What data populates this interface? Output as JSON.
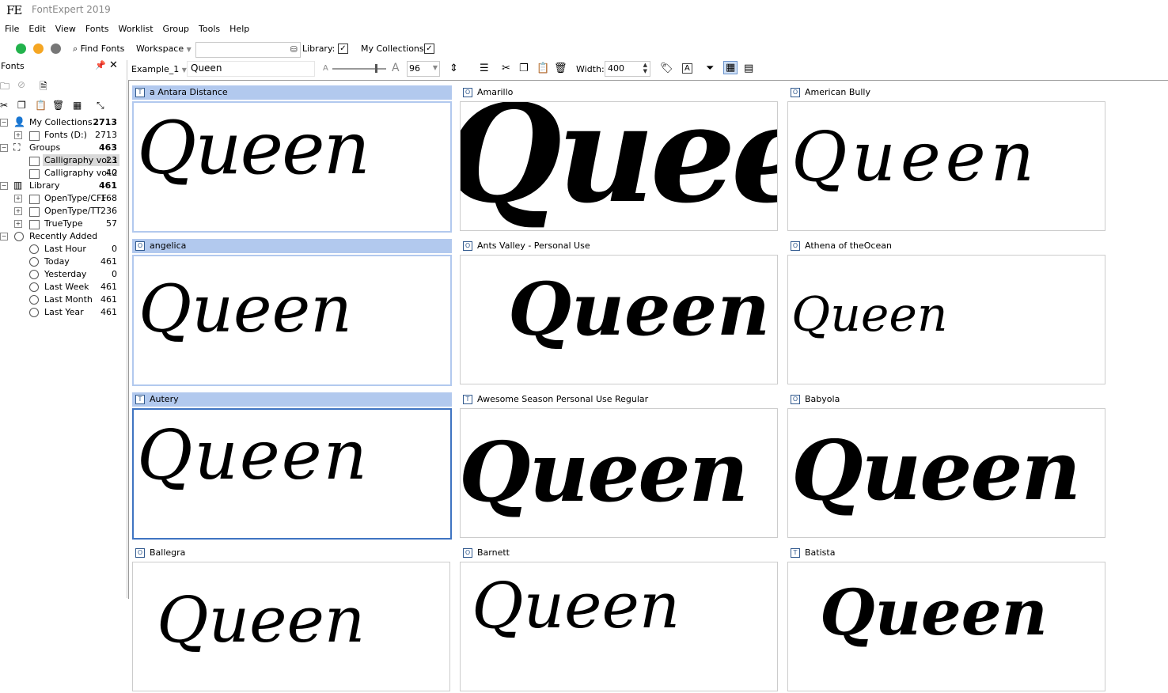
{
  "app": {
    "logo": "FE",
    "title": "FontExpert 2019"
  },
  "menu": [
    "File",
    "Edit",
    "View",
    "Fonts",
    "Worklist",
    "Group",
    "Tools",
    "Help"
  ],
  "toolbar1": {
    "find_fonts": "Find Fonts",
    "workspace": "Workspace",
    "library_label": "Library:",
    "collections_label": "My Collections:",
    "check": "✓"
  },
  "leftpanel": {
    "title": "Fonts",
    "tree": [
      {
        "label": "My Collections",
        "count": "2713",
        "bold": true
      },
      {
        "label": "Fonts (D:)",
        "count": "2713"
      },
      {
        "label": "Groups",
        "count": "463",
        "bold": true
      },
      {
        "label": "Calligraphy vol.1",
        "count": "23"
      },
      {
        "label": "Calligraphy vol.2",
        "count": "40"
      },
      {
        "label": "Library",
        "count": "461",
        "bold": true
      },
      {
        "label": "OpenType/CFF",
        "count": "168"
      },
      {
        "label": "OpenType/TT",
        "count": "236"
      },
      {
        "label": "TrueType",
        "count": "57"
      },
      {
        "label": "Recently Added",
        "count": ""
      },
      {
        "label": "Last Hour",
        "count": "0"
      },
      {
        "label": "Today",
        "count": "461"
      },
      {
        "label": "Yesterday",
        "count": "0"
      },
      {
        "label": "Last Week",
        "count": "461"
      },
      {
        "label": "Last Month",
        "count": "461"
      },
      {
        "label": "Last Year",
        "count": "461"
      }
    ]
  },
  "toolbar2": {
    "example": "Example_1",
    "sample_text": "Queen",
    "size": "96",
    "width_label": "Width:",
    "width_value": "400",
    "small_a": "A",
    "big_a": "A"
  },
  "cards": [
    {
      "name": "a Antara Distance",
      "type": "T"
    },
    {
      "name": "Amarillo",
      "type": "O"
    },
    {
      "name": "American Bully",
      "type": "O"
    },
    {
      "name": "angelica",
      "type": "O"
    },
    {
      "name": "Ants Valley - Personal Use",
      "type": "O"
    },
    {
      "name": "Athena of theOcean",
      "type": "O"
    },
    {
      "name": "Autery",
      "type": "T"
    },
    {
      "name": "Awesome Season Personal Use Regular",
      "type": "T"
    },
    {
      "name": "Babyola",
      "type": "O"
    },
    {
      "name": "Ballegra",
      "type": "O"
    },
    {
      "name": "Barnett",
      "type": "O"
    },
    {
      "name": "Batista",
      "type": "T"
    }
  ],
  "sample_word": "Queen"
}
